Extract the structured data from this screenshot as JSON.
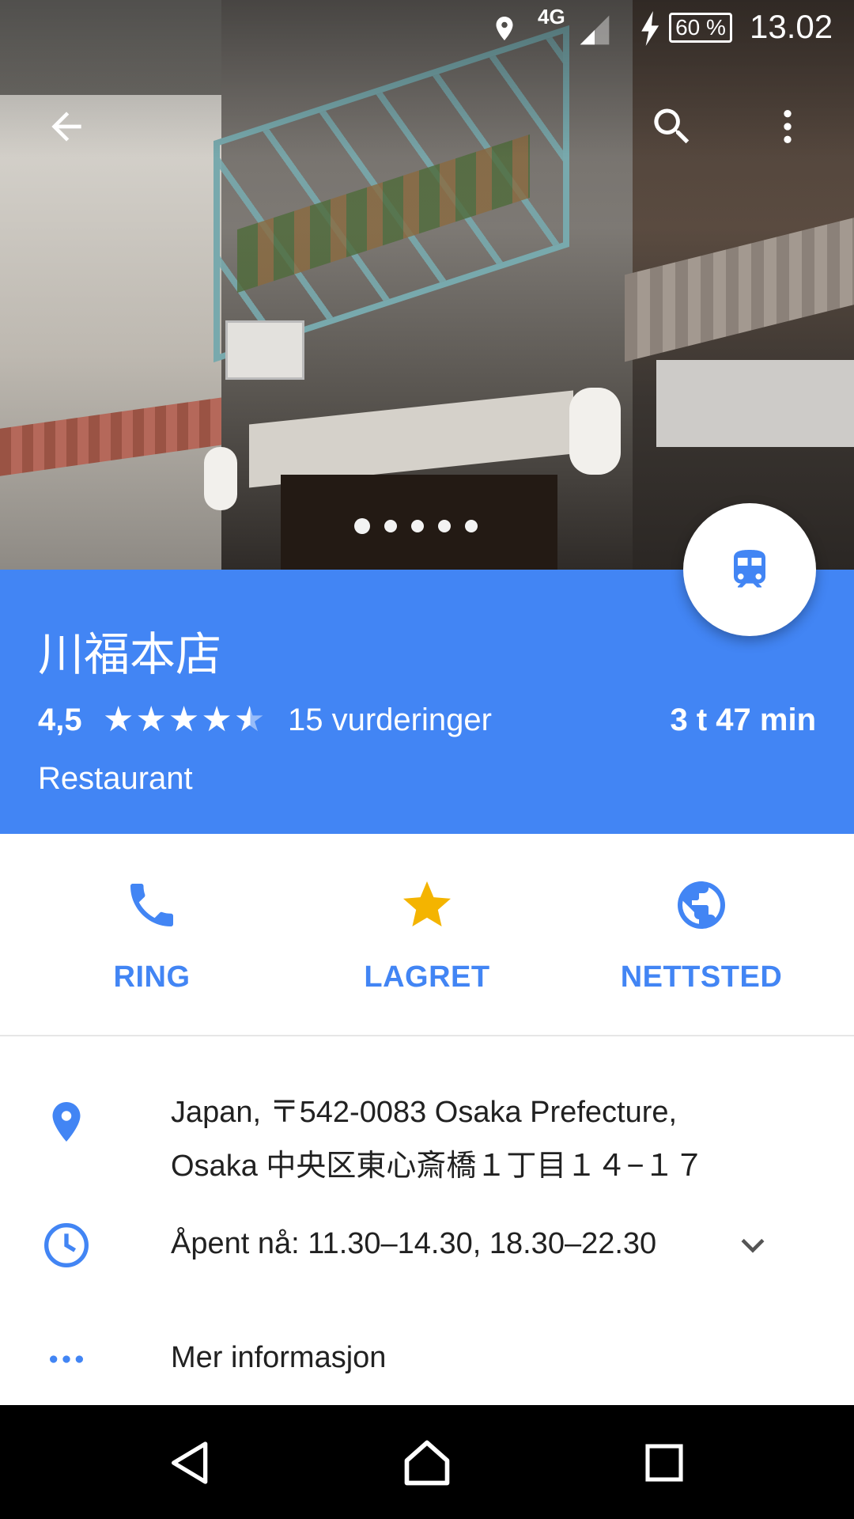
{
  "status_bar": {
    "network": "4G",
    "battery": "60 %",
    "time": "13.02",
    "icons": [
      "location-icon",
      "signal-icon",
      "charging-icon",
      "battery-icon"
    ]
  },
  "app_bar": {
    "icons": [
      "back-arrow-icon",
      "search-icon",
      "more-vert-icon"
    ]
  },
  "carousel": {
    "count": 5,
    "active_index": 0
  },
  "place": {
    "name": "川福本店",
    "rating": "4,5",
    "stars_value": 4.5,
    "reviews": "15 vurderinger",
    "travel_time": "3 t 47 min",
    "category": "Restaurant"
  },
  "fab": {
    "icon": "train-icon"
  },
  "actions": [
    {
      "label": "RING",
      "icon": "phone-icon"
    },
    {
      "label": "LAGRET",
      "icon": "star-icon"
    },
    {
      "label": "NETTSTED",
      "icon": "globe-icon"
    }
  ],
  "details": {
    "address_line1": "Japan, 〒542-0083 Osaka Prefecture,",
    "address_line2": "Osaka 中央区東心斎橋１丁目１４−１７",
    "hours": "Åpent nå: 11.30–14.30, 18.30–22.30",
    "more_info": "Mer informasjon"
  },
  "colors": {
    "primary": "#4285f4",
    "star_saved": "#f4b400",
    "text": "#212121"
  }
}
